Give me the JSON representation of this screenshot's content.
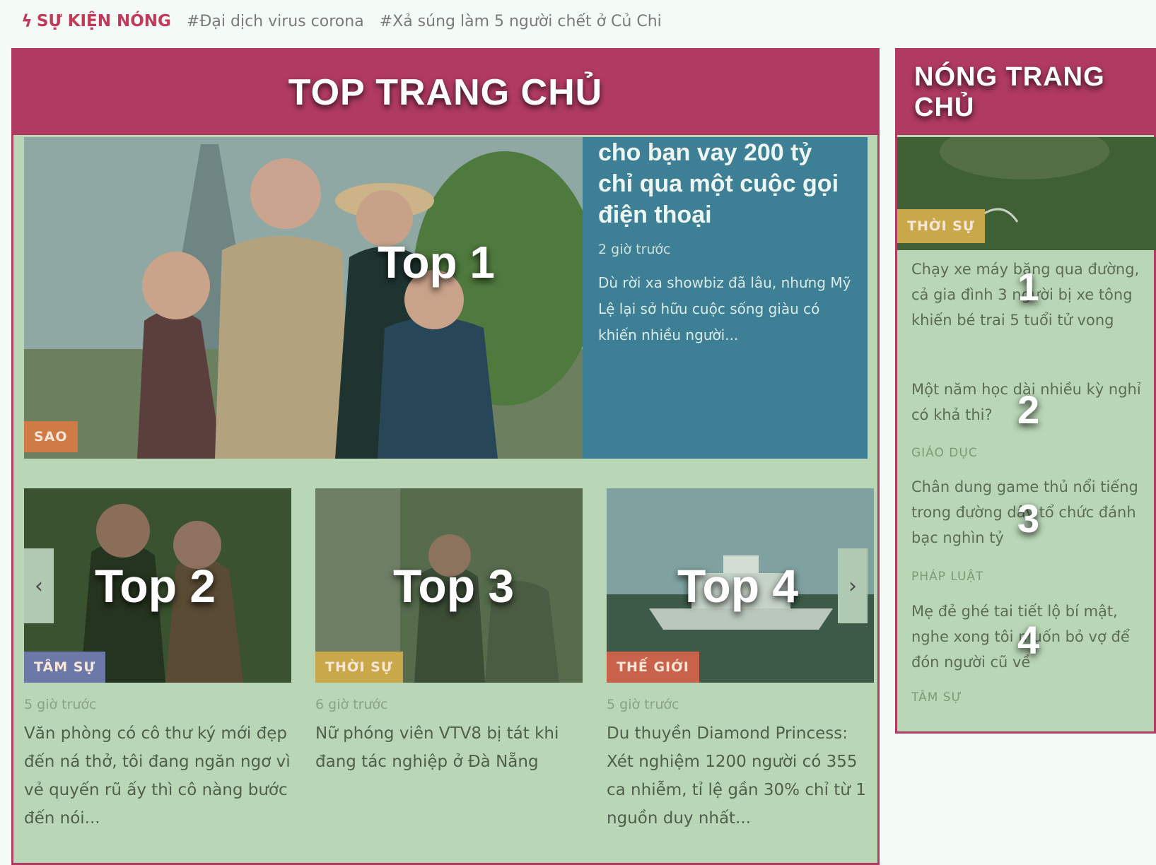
{
  "hotbar": {
    "label": "SỰ KIỆN NÓNG",
    "links": [
      "#Đại dịch virus corona",
      "#Xả súng làm 5 người chết ở Củ Chi"
    ]
  },
  "top_panel": {
    "title": "TOP TRANG CHỦ",
    "featured": {
      "overlay": "Top 1",
      "title": "cho bạn vay 200 tỷ chỉ qua một cuộc gọi điện thoại",
      "time": "2 giờ trước",
      "desc": "Dù rời xa showbiz đã lâu, nhưng Mỹ Lệ lại sở hữu cuộc sống giàu có khiến nhiều người...",
      "badge": "SAO"
    },
    "cards": [
      {
        "overlay": "Top 2",
        "badge": "TÂM SỰ",
        "time": "5 giờ trước",
        "title": "Văn phòng có cô thư ký mới đẹp đến ná thở, tôi đang ngăn ngơ vì vẻ quyến rũ ấy thì cô nàng bước đến nói..."
      },
      {
        "overlay": "Top 3",
        "badge": "THỜI SỰ",
        "time": "6 giờ trước",
        "title": "Nữ phóng viên VTV8 bị tát khi đang tác nghiệp ở Đà Nẵng"
      },
      {
        "overlay": "Top 4",
        "badge": "THẾ GIỚI",
        "time": "5 giờ trước",
        "title": "Du thuyền Diamond Princess: Xét nghiệm 1200 người có 355 ca nhiễm, tỉ lệ gần 30% chỉ từ 1 nguồn duy nhất..."
      }
    ],
    "prev": "‹",
    "next": "›"
  },
  "hot_panel": {
    "title": "NÓNG TRANG CHỦ",
    "image_badge": "THỜI SỰ",
    "items": [
      {
        "num": "1",
        "title": "Chạy xe máy băng qua đường, cả gia đình 3 người bị xe tông khiến bé trai 5 tuổi tử vong",
        "cat": ""
      },
      {
        "num": "2",
        "title": "Một năm học dài nhiều kỳ nghỉ có khả thi?",
        "cat": "GIÁO DỤC"
      },
      {
        "num": "3",
        "title": "Chân dung game thủ nổi tiếng trong đường dây tổ chức đánh bạc nghìn tỷ",
        "cat": "PHÁP LUẬT"
      },
      {
        "num": "4",
        "title": "Mẹ đẻ ghé tai tiết lộ bí mật, nghe xong tôi muốn bỏ vợ để đón người cũ về",
        "cat": "TÂM SỰ"
      }
    ]
  },
  "colors": {
    "brand": "#b03a62",
    "overlay_green": "#b9d7b6",
    "featured_blue": "#3d7f94",
    "badge_sao": "#d07a45",
    "badge_tamsu": "#6b78a8",
    "badge_thoisu": "#c9a84a",
    "badge_thegioi": "#c9624a"
  }
}
